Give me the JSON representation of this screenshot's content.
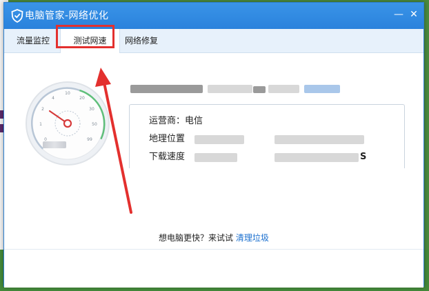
{
  "window": {
    "title": "电脑管家-网络优化",
    "minimize_glyph": "—",
    "close_glyph": "✕"
  },
  "tabs": [
    {
      "label": "流量监控",
      "active": false
    },
    {
      "label": "测试网速",
      "active": true
    },
    {
      "label": "网络修复",
      "active": false
    }
  ],
  "gauge": {
    "ticks": [
      "0",
      "1",
      "2",
      "4",
      "10",
      "20",
      "30",
      "50",
      "99"
    ],
    "needle_value": 2
  },
  "info": {
    "carrier_label": "运营商：电信",
    "location_label": "地理位置",
    "download_label": "下载速度",
    "download_suffix": "S"
  },
  "footer": {
    "prompt": "想电脑更快？来试试",
    "link": "清理垃圾"
  },
  "colors": {
    "titlebar": "#2a82dc",
    "highlight": "#e3302e",
    "link": "#1a6fcf"
  }
}
